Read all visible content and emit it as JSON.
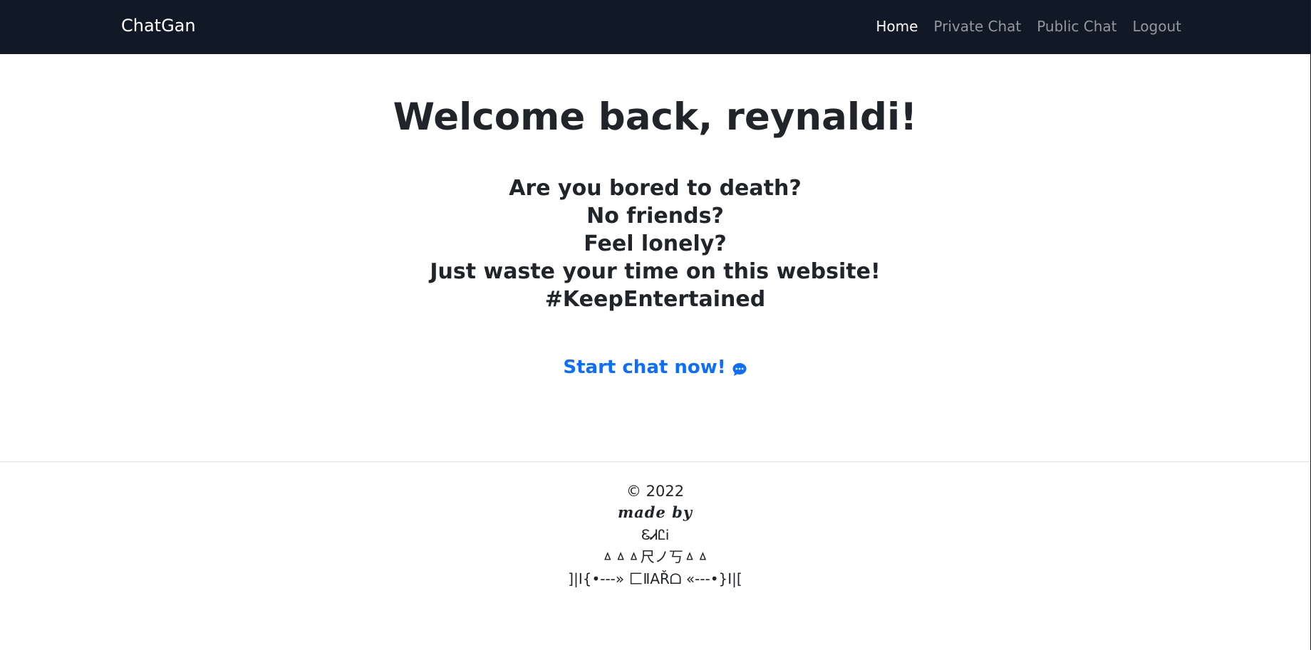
{
  "navbar": {
    "brand": "ChatGan",
    "links": [
      {
        "label": "Home",
        "active": true
      },
      {
        "label": "Private Chat",
        "active": false
      },
      {
        "label": "Public Chat",
        "active": false
      },
      {
        "label": "Logout",
        "active": false
      }
    ]
  },
  "main": {
    "welcome": "Welcome back, reynaldi!",
    "pitch_lines": [
      "Are you bored to death?",
      "No friends?",
      "Feel lonely?",
      "Just waste your time on this website!",
      "#KeepEntertained"
    ],
    "cta_label": "Start chat now!",
    "cta_icon": "chat-bubble-icon"
  },
  "footer": {
    "copyright": "© 2022",
    "made_by": "made by",
    "line_3": "ᏋᏗᏝᎥ",
    "line_4": "ㅿㅿㅿ尺ノ丂ㅿㅿ",
    "line_5": "]|I{•---» 匚ⅡAŘᗝ «---•}I|["
  },
  "colors": {
    "navbar_bg": "#111826",
    "link_primary": "#0d6efd",
    "text_dark": "#212529"
  }
}
